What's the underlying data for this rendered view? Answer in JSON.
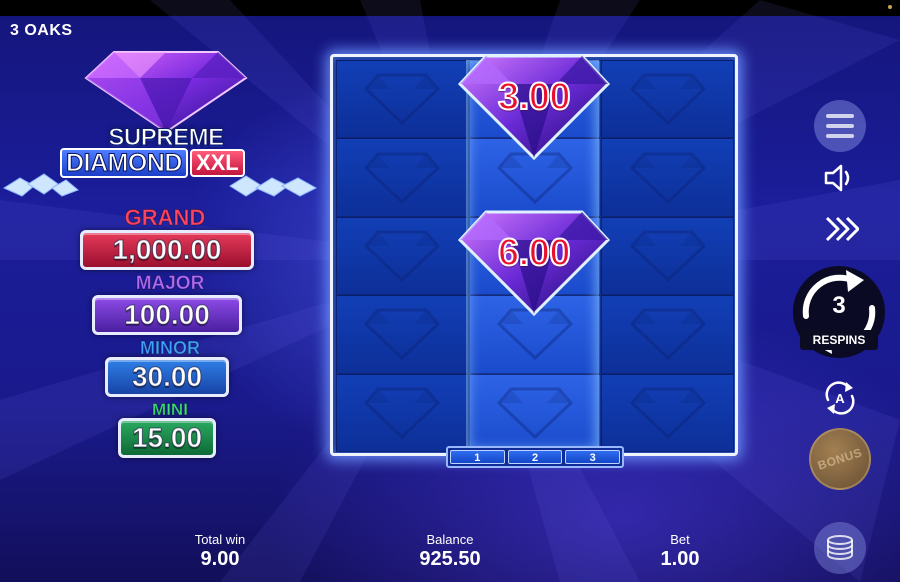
{
  "app": {
    "brand": "3 OAKS"
  },
  "logo": {
    "line1": "SUPREME",
    "line2_diamond": "DIAMOND",
    "line2_xxl": "XXL"
  },
  "jackpots": [
    {
      "label": "GRAND",
      "value": "1,000.00",
      "color": "#e63a5a"
    },
    {
      "label": "MAJOR",
      "value": "100.00",
      "color": "#8d4be6"
    },
    {
      "label": "MINOR",
      "value": "30.00",
      "color": "#2f7fe6"
    },
    {
      "label": "MINI",
      "value": "15.00",
      "color": "#2aa860"
    }
  ],
  "reels": {
    "gems": [
      {
        "value": "3.00",
        "reel": 2,
        "row": 1
      },
      {
        "value": "6.00",
        "reel": 2,
        "row": 3
      }
    ],
    "tabs": [
      "1",
      "2",
      "3"
    ]
  },
  "controls": {
    "menu_icon": "menu-icon",
    "sound_icon": "speaker-icon",
    "turbo_icon": "fast-forward-icon",
    "respins_count": "3",
    "respins_label": "RESPINS",
    "autoplay_letter": "A",
    "bonus_label": "BONUS",
    "bet_icon": "coin-stack-icon"
  },
  "stats": {
    "total_win_label": "Total win",
    "total_win_value": "9.00",
    "balance_label": "Balance",
    "balance_value": "925.50",
    "bet_label": "Bet",
    "bet_value": "1.00"
  }
}
